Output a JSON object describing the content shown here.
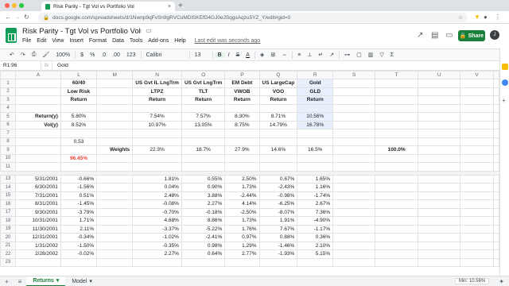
{
  "browser": {
    "tab_title": "Risk Parity - Tgt Vol vs Portfolio Vol",
    "tab_close": "×",
    "new_tab": "+",
    "url": "docs.google.com/spreadsheets/d/1Nwnp9qFvSn9gRVCuMDlSKEfD4GJ0eJSqgsAqzu5YZ_Y/edit#gid=0"
  },
  "sheets": {
    "doc_title": "Risk Parity - Tgt Vol vs Portfolio Vol",
    "menu": [
      "File",
      "Edit",
      "View",
      "Insert",
      "Format",
      "Data",
      "Tools",
      "Add-ons",
      "Help"
    ],
    "last_edit": "Last edit was seconds ago",
    "share_label": "Share",
    "avatar_initial": "J"
  },
  "toolbar": {
    "zoom": "100%",
    "currency": "$",
    "percent": "%",
    "dec_less": ".0",
    "dec_more": ".00",
    "number_format": "123",
    "font": "Calibri",
    "font_size": "13",
    "bold": "B",
    "italic": "I",
    "strike": "S",
    "text_color": "A"
  },
  "formula_bar": {
    "name_box": "R1:96",
    "fx": "fx",
    "value": "Gold"
  },
  "columns": [
    "A",
    "L",
    "M",
    "N",
    "O",
    "P",
    "Q",
    "R",
    "S",
    "T",
    "U",
    "V"
  ],
  "rows_top": [
    {
      "n": "1",
      "cells": [
        "",
        "60/40",
        "",
        "US Gvt IL LngTrm",
        "US Gvt LngTrm",
        "EM Debt",
        "US LargeCap",
        "Gold",
        "",
        "",
        "",
        ""
      ]
    },
    {
      "n": "2",
      "cells": [
        "",
        "Low Risk",
        "",
        "LTPZ",
        "TLT",
        "VWOB",
        "VOO",
        "GLD",
        "",
        "",
        "",
        ""
      ]
    },
    {
      "n": "3",
      "cells": [
        "",
        "Return",
        "",
        "Return",
        "Return",
        "Return",
        "Return",
        "Return",
        "",
        "",
        "",
        ""
      ]
    },
    {
      "n": "4",
      "cells": [
        "",
        "",
        "",
        "",
        "",
        "",
        "",
        "",
        "",
        "",
        "",
        ""
      ]
    },
    {
      "n": "5",
      "cells": [
        "Return(y)",
        "5.80%",
        "",
        "7.54%",
        "7.57%",
        "8.30%",
        "8.71%",
        "10.56%",
        "",
        "",
        "",
        ""
      ]
    },
    {
      "n": "6",
      "cells": [
        "Vol(y)",
        "8.52%",
        "",
        "10.97%",
        "13.05%",
        "8.75%",
        "14.79%",
        "16.78%",
        "",
        "",
        "",
        ""
      ]
    },
    {
      "n": "7",
      "cells": [
        "",
        "",
        "",
        "",
        "",
        "",
        "",
        "",
        "",
        "",
        "",
        ""
      ]
    },
    {
      "n": "8",
      "cells": [
        "",
        "0.53",
        "",
        "",
        "",
        "",
        "",
        "",
        "",
        "",
        "",
        ""
      ]
    },
    {
      "n": "9",
      "cells": [
        "",
        "",
        "Weights",
        "22.3%",
        "18.7%",
        "27.9%",
        "14.6%",
        "16.5%",
        "",
        "100.0%",
        "",
        ""
      ]
    },
    {
      "n": "10",
      "cells": [
        "",
        "96.45%",
        "",
        "",
        "",
        "",
        "",
        "",
        "",
        "",
        "",
        ""
      ]
    },
    {
      "n": "11",
      "cells": [
        "",
        "",
        "",
        "",
        "",
        "",
        "",
        "",
        "",
        "",
        "",
        ""
      ]
    }
  ],
  "rows_data": [
    {
      "n": "13",
      "cells": [
        "5/31/2001",
        "-0.66%",
        "",
        "1.81%",
        "0.55%",
        "2.50%",
        "0.67%",
        "1.65%",
        "",
        "",
        "",
        ""
      ]
    },
    {
      "n": "14",
      "cells": [
        "6/30/2001",
        "-1.56%",
        "",
        "0.04%",
        "0.90%",
        "1.73%",
        "-2.43%",
        "1.16%",
        "",
        "",
        "",
        ""
      ]
    },
    {
      "n": "15",
      "cells": [
        "7/31/2001",
        "0.51%",
        "",
        "2.48%",
        "3.88%",
        "-2.44%",
        "-0.98%",
        "-1.74%",
        "",
        "",
        "",
        ""
      ]
    },
    {
      "n": "16",
      "cells": [
        "8/31/2001",
        "-1.45%",
        "",
        "-0.08%",
        "2.27%",
        "4.14%",
        "-6.25%",
        "2.67%",
        "",
        "",
        "",
        ""
      ]
    },
    {
      "n": "17",
      "cells": [
        "9/30/2001",
        "-3.79%",
        "",
        "-0.70%",
        "-0.18%",
        "-2.50%",
        "-8.07%",
        "7.36%",
        "",
        "",
        "",
        ""
      ]
    },
    {
      "n": "18",
      "cells": [
        "10/31/2001",
        "1.71%",
        "",
        "4.68%",
        "8.86%",
        "1.73%",
        "1.91%",
        "-4.90%",
        "",
        "",
        "",
        ""
      ]
    },
    {
      "n": "19",
      "cells": [
        "11/30/2001",
        "2.11%",
        "",
        "-3.37%",
        "-5.22%",
        "1.76%",
        "7.67%",
        "-1.17%",
        "",
        "",
        "",
        ""
      ]
    },
    {
      "n": "20",
      "cells": [
        "12/31/2001",
        "-0.34%",
        "",
        "-1.02%",
        "-2.41%",
        "0.97%",
        "0.88%",
        "0.36%",
        "",
        "",
        "",
        ""
      ]
    },
    {
      "n": "21",
      "cells": [
        "1/31/2002",
        "-1.50%",
        "",
        "-0.35%",
        "0.98%",
        "1.29%",
        "-1.46%",
        "2.10%",
        "",
        "",
        "",
        ""
      ]
    },
    {
      "n": "22",
      "cells": [
        "2/28/2002",
        "-0.02%",
        "",
        "2.27%",
        "0.64%",
        "2.77%",
        "-1.93%",
        "5.15%",
        "",
        "",
        "",
        ""
      ]
    },
    {
      "n": "23",
      "cells": [
        "",
        "",
        "",
        "",
        "",
        "",
        "",
        "",
        "",
        "",
        "",
        ""
      ]
    }
  ],
  "sheet_tabs": [
    "Returns",
    "Model"
  ],
  "sum_box": "Min: 10.56%",
  "colors": {
    "accent": "#188038",
    "selection": "#e8f0fe",
    "red": "#ea4335"
  }
}
